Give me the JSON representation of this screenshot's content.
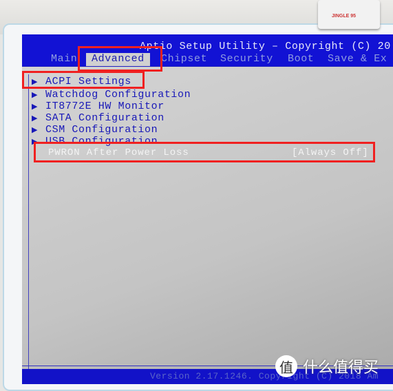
{
  "header": {
    "title": "Aptio Setup Utility – Copyright (C) 20"
  },
  "tabs": [
    {
      "label": "Main"
    },
    {
      "label": "Advanced",
      "active": true
    },
    {
      "label": "Chipset"
    },
    {
      "label": "Security"
    },
    {
      "label": "Boot"
    },
    {
      "label": "Save & Ex"
    }
  ],
  "menu": {
    "items": [
      {
        "label": "ACPI Settings"
      },
      {
        "label": "Watchdog Configuration"
      },
      {
        "label": "IT8772E HW Monitor"
      },
      {
        "label": "SATA Configuration"
      },
      {
        "label": "CSM Configuration"
      },
      {
        "label": "USB Configuration"
      }
    ],
    "selected": {
      "label": "PWRON After Power Loss",
      "value": "[Always Off]"
    }
  },
  "footer": {
    "text": "Version 2.17.1246. Copyright (C) 2018 Am"
  },
  "webcam_label": "JINGLE 95",
  "watermark": {
    "logo": "值",
    "text": "什么值得买"
  },
  "colors": {
    "bios_blue": "#1212d4",
    "highlight_box": "#f02020",
    "body_gray": "#c8c8c8"
  }
}
